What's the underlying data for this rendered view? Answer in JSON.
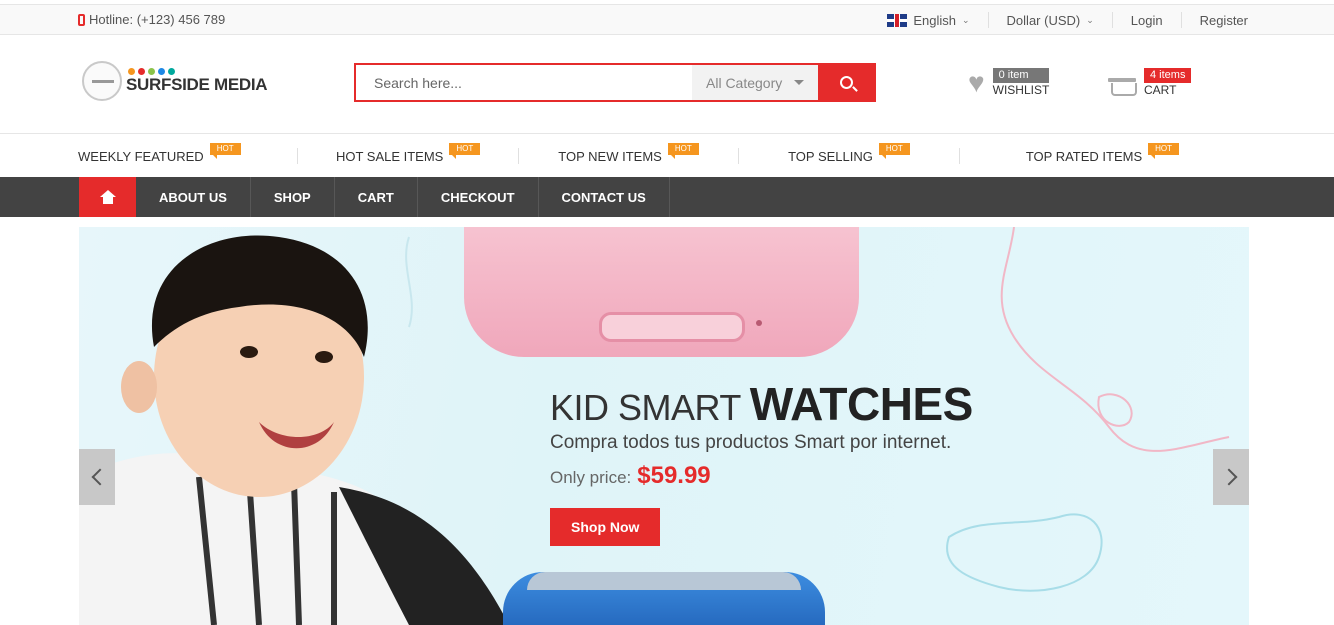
{
  "topbar": {
    "hotline": "Hotline: (+123) 456 789",
    "language": "English",
    "currency": "Dollar (USD)",
    "login": "Login",
    "register": "Register"
  },
  "header": {
    "logo_text": "SURFSIDE MEDIA",
    "logo_dot_colors": [
      "#f5961f",
      "#e52b2b",
      "#8bc34a",
      "#1e88e5",
      "#00a99d"
    ],
    "search_placeholder": "Search here...",
    "category": "All Category",
    "wishlist": {
      "count": "0 item",
      "label": "WISHLIST"
    },
    "cart": {
      "count": "4 items",
      "label": "CART"
    }
  },
  "hot_nav": [
    {
      "label": "WEEKLY FEATURED",
      "badge": "HOT"
    },
    {
      "label": "HOT SALE ITEMS",
      "badge": "HOT"
    },
    {
      "label": "TOP NEW ITEMS",
      "badge": "HOT"
    },
    {
      "label": "TOP SELLING",
      "badge": "HOT"
    },
    {
      "label": "TOP RATED ITEMS",
      "badge": "HOT"
    }
  ],
  "main_nav": [
    "ABOUT US",
    "SHOP",
    "CART",
    "CHECKOUT",
    "CONTACT US"
  ],
  "slide": {
    "headline_light": "KID SMART",
    "headline_bold": "WATCHES",
    "subheadline": "Compra todos tus productos Smart por internet.",
    "price_label": "Only price:",
    "price": "$59.99",
    "cta": "Shop Now"
  },
  "colors": {
    "accent": "#e52b2b",
    "hot": "#f5961f",
    "nav_bg": "#434343",
    "wishlist_badge": "#777777"
  }
}
